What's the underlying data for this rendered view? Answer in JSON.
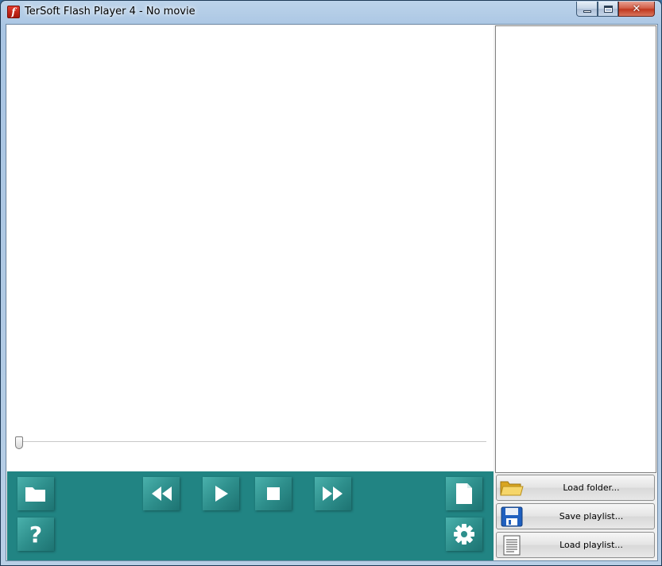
{
  "window": {
    "title": "TerSoft Flash Player 4 - No movie",
    "app_icon_letter": "f",
    "close_glyph": "✕"
  },
  "player": {
    "seek_position": 0,
    "accent_color": "#218483"
  },
  "controls": {
    "icons": [
      "folder-open-icon",
      "help-icon",
      "rewind-icon",
      "play-icon",
      "stop-icon",
      "fast-forward-icon",
      "document-icon",
      "settings-icon"
    ],
    "help_glyph": "?"
  },
  "playlist": {
    "items": [],
    "buttons": {
      "load_folder": "Load folder...",
      "save_playlist": "Save playlist...",
      "load_playlist": "Load playlist..."
    }
  }
}
